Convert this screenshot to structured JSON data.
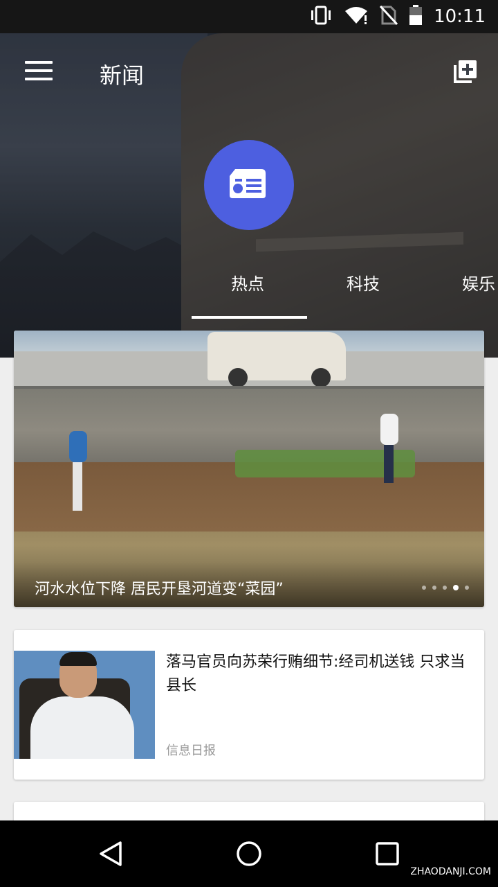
{
  "status_bar": {
    "time": "10:11",
    "icons": [
      "vibrate-icon",
      "wifi-icon",
      "no-sim-icon",
      "battery-icon"
    ]
  },
  "app_bar": {
    "title": "新闻",
    "menu_icon": "menu-icon",
    "action_icon": "add-library-icon"
  },
  "category": {
    "icon": "news-card-icon",
    "accent_color": "#4d5fe0"
  },
  "tabs": [
    {
      "label": "热点",
      "selected": true
    },
    {
      "label": "科技",
      "selected": false
    },
    {
      "label": "娱乐",
      "selected": false
    }
  ],
  "banner": {
    "caption": "河水水位下降 居民开垦河道变“菜园”",
    "dots_total": 5,
    "dots_active_index": 3
  },
  "news": [
    {
      "title": "落马官员向苏荣行贿细节:经司机送钱 只求当县长",
      "source": "信息日报"
    }
  ],
  "nav_bar": {
    "buttons": [
      "back-icon",
      "home-icon",
      "recents-icon"
    ]
  },
  "watermark": "ZHAODANJI.COM"
}
